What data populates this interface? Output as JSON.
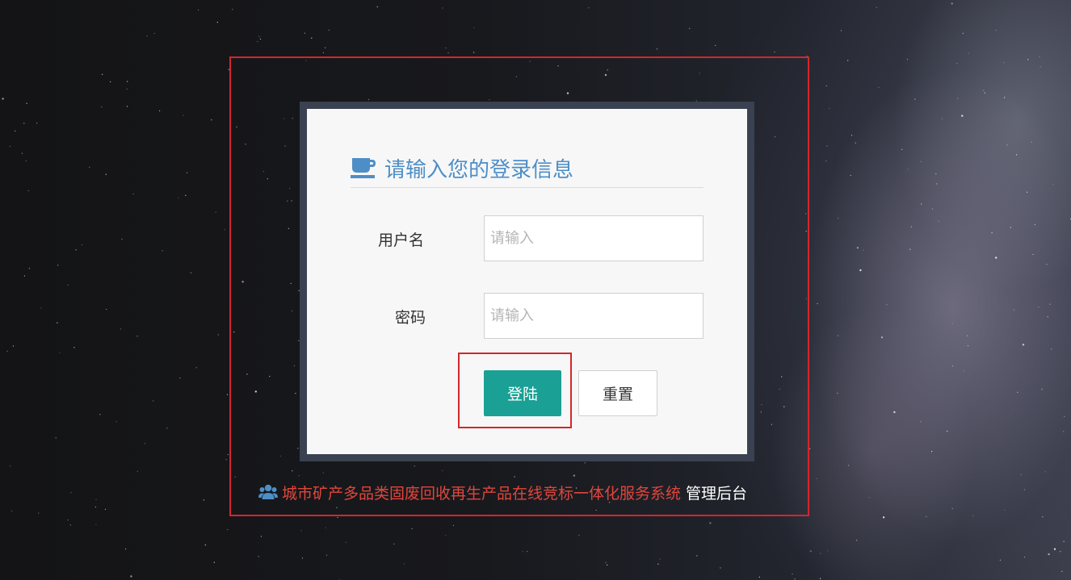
{
  "login_card": {
    "title": "请输入您的登录信息",
    "title_icon": "coffee-icon",
    "username_label": "用户名",
    "username_placeholder": "请输入",
    "username_value": "",
    "password_label": "密码",
    "password_placeholder": "请输入",
    "password_value": "",
    "login_button": "登陆",
    "reset_button": "重置"
  },
  "footer": {
    "icon": "users-icon",
    "system_name": "城市矿产多品类固废回收再生产品在线竞标一体化服务系统",
    "suffix": "管理后台"
  },
  "colors": {
    "accent_title": "#4d8ec7",
    "login_button": "#1aa094",
    "system_name": "#e0463c",
    "annotation_frame": "#d4262c",
    "card_border": "#3a4150",
    "card_background": "#f7f7f7"
  }
}
